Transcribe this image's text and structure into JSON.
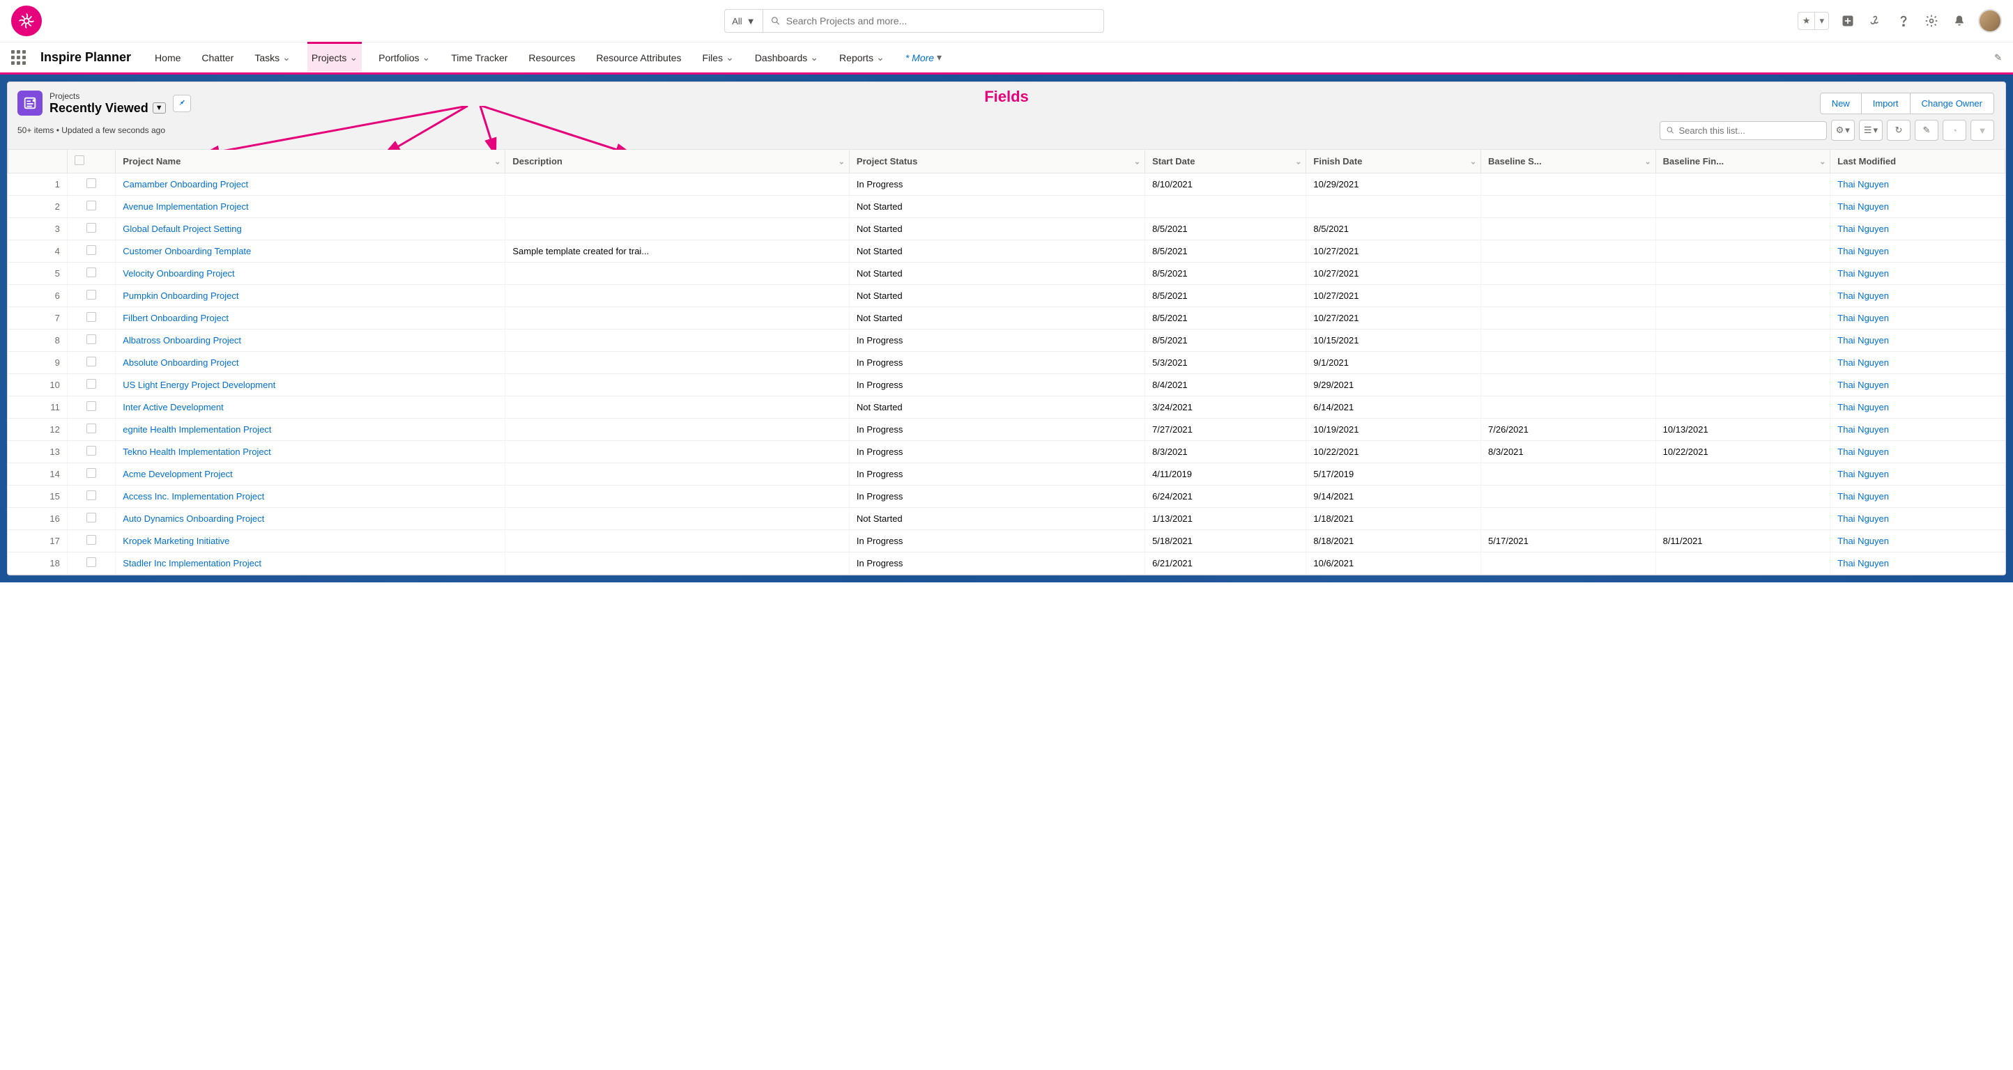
{
  "header": {
    "search_scope": "All",
    "search_placeholder": "Search Projects and more..."
  },
  "nav": {
    "app_name": "Inspire Planner",
    "items": [
      {
        "label": "Home",
        "chevron": false,
        "active": false
      },
      {
        "label": "Chatter",
        "chevron": false,
        "active": false
      },
      {
        "label": "Tasks",
        "chevron": true,
        "active": false
      },
      {
        "label": "Projects",
        "chevron": true,
        "active": true
      },
      {
        "label": "Portfolios",
        "chevron": true,
        "active": false
      },
      {
        "label": "Time Tracker",
        "chevron": false,
        "active": false
      },
      {
        "label": "Resources",
        "chevron": false,
        "active": false
      },
      {
        "label": "Resource Attributes",
        "chevron": false,
        "active": false
      },
      {
        "label": "Files",
        "chevron": true,
        "active": false
      },
      {
        "label": "Dashboards",
        "chevron": true,
        "active": false
      },
      {
        "label": "Reports",
        "chevron": true,
        "active": false
      }
    ],
    "more_label": "* More"
  },
  "listview": {
    "object_label": "Projects",
    "view_name": "Recently Viewed",
    "meta": "50+ items • Updated a few seconds ago",
    "actions": {
      "new": "New",
      "import": "Import",
      "change_owner": "Change Owner"
    },
    "search_placeholder": "Search this list..."
  },
  "annotation": {
    "label": "Fields"
  },
  "columns": [
    {
      "key": "name",
      "label": "Project Name"
    },
    {
      "key": "desc",
      "label": "Description"
    },
    {
      "key": "status",
      "label": "Project Status"
    },
    {
      "key": "start",
      "label": "Start Date"
    },
    {
      "key": "finish",
      "label": "Finish Date"
    },
    {
      "key": "bs",
      "label": "Baseline S..."
    },
    {
      "key": "bf",
      "label": "Baseline Fin..."
    },
    {
      "key": "mod",
      "label": "Last Modified"
    }
  ],
  "rows": [
    {
      "n": "1",
      "name": "Camamber Onboarding Project",
      "desc": "",
      "status": "In Progress",
      "start": "8/10/2021",
      "finish": "10/29/2021",
      "bs": "",
      "bf": "",
      "mod": "Thai Nguyen"
    },
    {
      "n": "2",
      "name": "Avenue Implementation Project",
      "desc": "",
      "status": "Not Started",
      "start": "",
      "finish": "",
      "bs": "",
      "bf": "",
      "mod": "Thai Nguyen"
    },
    {
      "n": "3",
      "name": "Global Default Project Setting",
      "desc": "",
      "status": "Not Started",
      "start": "8/5/2021",
      "finish": "8/5/2021",
      "bs": "",
      "bf": "",
      "mod": "Thai Nguyen"
    },
    {
      "n": "4",
      "name": "Customer Onboarding Template",
      "desc": "Sample template created for trai...",
      "status": "Not Started",
      "start": "8/5/2021",
      "finish": "10/27/2021",
      "bs": "",
      "bf": "",
      "mod": "Thai Nguyen"
    },
    {
      "n": "5",
      "name": "Velocity Onboarding Project",
      "desc": "",
      "status": "Not Started",
      "start": "8/5/2021",
      "finish": "10/27/2021",
      "bs": "",
      "bf": "",
      "mod": "Thai Nguyen"
    },
    {
      "n": "6",
      "name": "Pumpkin Onboarding Project",
      "desc": "",
      "status": "Not Started",
      "start": "8/5/2021",
      "finish": "10/27/2021",
      "bs": "",
      "bf": "",
      "mod": "Thai Nguyen"
    },
    {
      "n": "7",
      "name": "Filbert Onboarding Project",
      "desc": "",
      "status": "Not Started",
      "start": "8/5/2021",
      "finish": "10/27/2021",
      "bs": "",
      "bf": "",
      "mod": "Thai Nguyen"
    },
    {
      "n": "8",
      "name": "Albatross Onboarding Project",
      "desc": "",
      "status": "In Progress",
      "start": "8/5/2021",
      "finish": "10/15/2021",
      "bs": "",
      "bf": "",
      "mod": "Thai Nguyen"
    },
    {
      "n": "9",
      "name": "Absolute Onboarding Project",
      "desc": "",
      "status": "In Progress",
      "start": "5/3/2021",
      "finish": "9/1/2021",
      "bs": "",
      "bf": "",
      "mod": "Thai Nguyen"
    },
    {
      "n": "10",
      "name": "US Light Energy Project Development",
      "desc": "",
      "status": "In Progress",
      "start": "8/4/2021",
      "finish": "9/29/2021",
      "bs": "",
      "bf": "",
      "mod": "Thai Nguyen"
    },
    {
      "n": "11",
      "name": "Inter Active Development",
      "desc": "",
      "status": "Not Started",
      "start": "3/24/2021",
      "finish": "6/14/2021",
      "bs": "",
      "bf": "",
      "mod": "Thai Nguyen"
    },
    {
      "n": "12",
      "name": "egnite Health Implementation Project",
      "desc": "",
      "status": "In Progress",
      "start": "7/27/2021",
      "finish": "10/19/2021",
      "bs": "7/26/2021",
      "bf": "10/13/2021",
      "mod": "Thai Nguyen"
    },
    {
      "n": "13",
      "name": "Tekno Health Implementation Project",
      "desc": "",
      "status": "In Progress",
      "start": "8/3/2021",
      "finish": "10/22/2021",
      "bs": "8/3/2021",
      "bf": "10/22/2021",
      "mod": "Thai Nguyen"
    },
    {
      "n": "14",
      "name": "Acme Development Project",
      "desc": "",
      "status": "In Progress",
      "start": "4/11/2019",
      "finish": "5/17/2019",
      "bs": "",
      "bf": "",
      "mod": "Thai Nguyen"
    },
    {
      "n": "15",
      "name": "Access Inc. Implementation Project",
      "desc": "",
      "status": "In Progress",
      "start": "6/24/2021",
      "finish": "9/14/2021",
      "bs": "",
      "bf": "",
      "mod": "Thai Nguyen"
    },
    {
      "n": "16",
      "name": "Auto Dynamics Onboarding Project",
      "desc": "",
      "status": "Not Started",
      "start": "1/13/2021",
      "finish": "1/18/2021",
      "bs": "",
      "bf": "",
      "mod": "Thai Nguyen"
    },
    {
      "n": "17",
      "name": "Kropek Marketing Initiative",
      "desc": "",
      "status": "In Progress",
      "start": "5/18/2021",
      "finish": "8/18/2021",
      "bs": "5/17/2021",
      "bf": "8/11/2021",
      "mod": "Thai Nguyen"
    },
    {
      "n": "18",
      "name": "Stadler Inc Implementation Project",
      "desc": "",
      "status": "In Progress",
      "start": "6/21/2021",
      "finish": "10/6/2021",
      "bs": "",
      "bf": "",
      "mod": "Thai Nguyen"
    }
  ]
}
